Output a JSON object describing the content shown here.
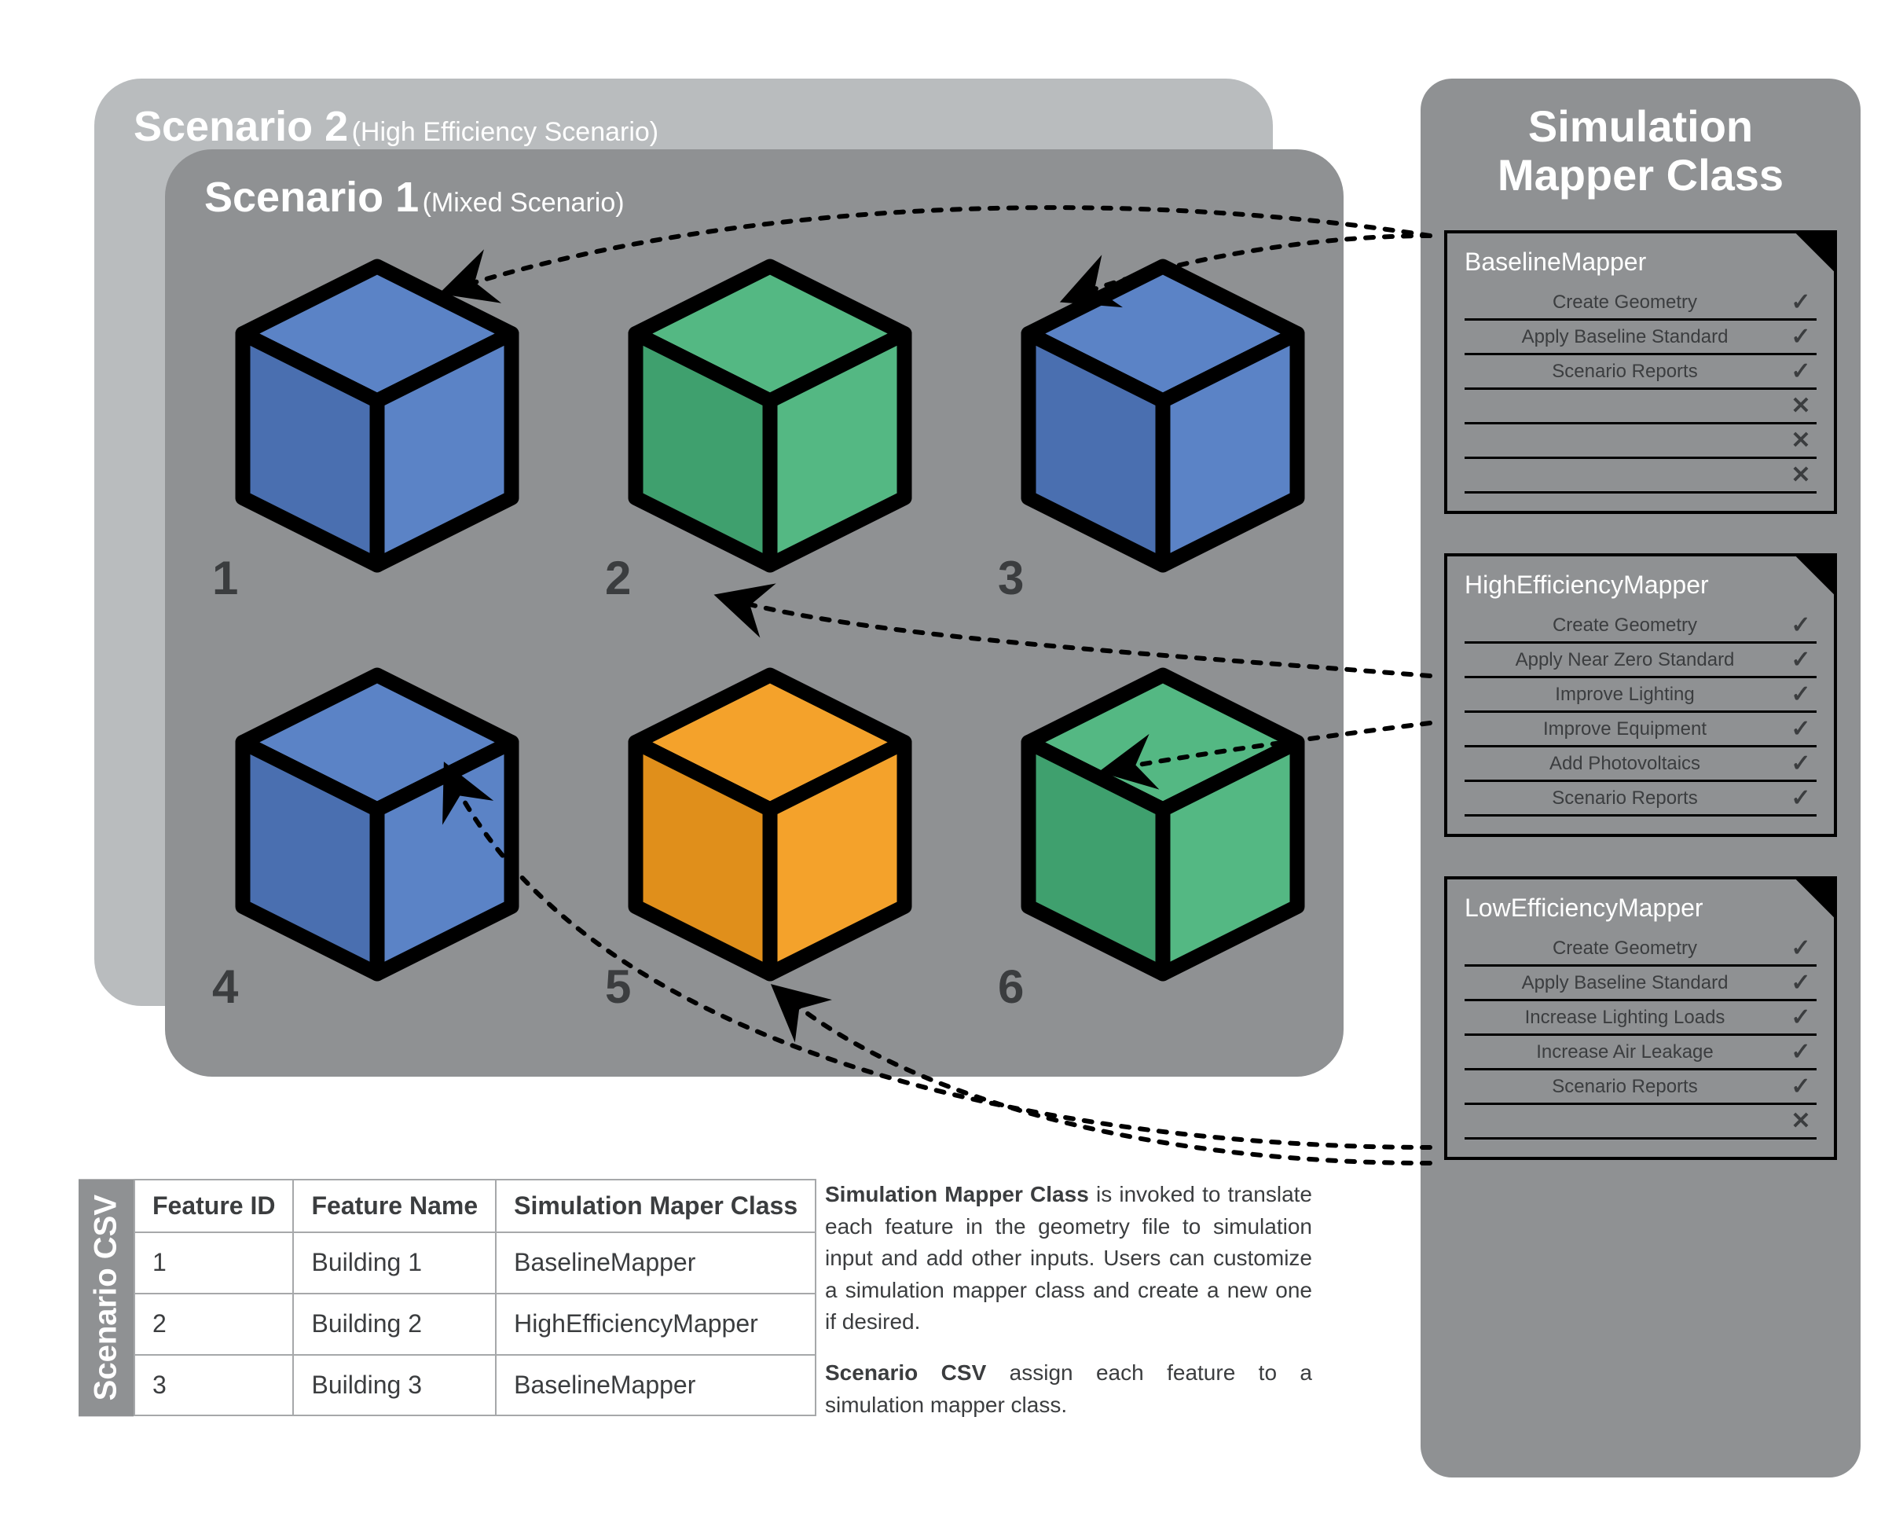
{
  "scenarios": {
    "s2": {
      "title": "Scenario 2",
      "sub": "(High Efficiency Scenario)"
    },
    "s1": {
      "title": "Scenario 1",
      "sub": "(Mixed Scenario)"
    }
  },
  "cubes": [
    {
      "n": "1",
      "color": "blue"
    },
    {
      "n": "2",
      "color": "green"
    },
    {
      "n": "3",
      "color": "blue"
    },
    {
      "n": "4",
      "color": "blue"
    },
    {
      "n": "5",
      "color": "orange"
    },
    {
      "n": "6",
      "color": "green"
    }
  ],
  "cube_colors": {
    "blue": {
      "top": "#5b83c6",
      "left": "#4a6fb0",
      "right": "#5b83c6"
    },
    "green": {
      "top": "#54b883",
      "left": "#3fa06e",
      "right": "#54b883"
    },
    "orange": {
      "top": "#f4a22b",
      "left": "#e08f1b",
      "right": "#f4a22b"
    }
  },
  "sidebar": {
    "title_l1": "Simulation",
    "title_l2": "Mapper Class",
    "mappers": [
      {
        "name": "BaselineMapper",
        "lines": [
          {
            "label": "Create Geometry",
            "check": true
          },
          {
            "label": "Apply Baseline Standard",
            "check": true
          },
          {
            "label": "Scenario Reports",
            "check": true
          },
          {
            "label": "",
            "check": false
          },
          {
            "label": "",
            "check": false
          },
          {
            "label": "",
            "check": false
          }
        ]
      },
      {
        "name": "HighEfficiencyMapper",
        "lines": [
          {
            "label": "Create Geometry",
            "check": true
          },
          {
            "label": "Apply Near Zero Standard",
            "check": true
          },
          {
            "label": "Improve Lighting",
            "check": true
          },
          {
            "label": "Improve Equipment",
            "check": true
          },
          {
            "label": "Add Photovoltaics",
            "check": true
          },
          {
            "label": "Scenario Reports",
            "check": true
          }
        ]
      },
      {
        "name": "LowEfficiencyMapper",
        "lines": [
          {
            "label": "Create Geometry",
            "check": true
          },
          {
            "label": "Apply Baseline Standard",
            "check": true
          },
          {
            "label": "Increase Lighting Loads",
            "check": true
          },
          {
            "label": "Increase Air Leakage",
            "check": true
          },
          {
            "label": "Scenario Reports",
            "check": true
          },
          {
            "label": "",
            "check": false
          }
        ]
      }
    ]
  },
  "csv": {
    "tab": "Scenario CSV",
    "headers": [
      "Feature ID",
      "Feature Name",
      "Simulation Maper Class"
    ],
    "rows": [
      [
        "1",
        "Building 1",
        "BaselineMapper"
      ],
      [
        "2",
        "Building 2",
        "HighEfficiencyMapper"
      ],
      [
        "3",
        "Building 3",
        "BaselineMapper"
      ]
    ]
  },
  "desc": {
    "p1_b": "Simulation Mapper Class",
    "p1": " is invoked to translate each feature in the geometry file to simulation input and add other inputs. Users can customize a simulation mapper class and create a new one if desired.",
    "p2_b": "Scenario CSV",
    "p2": " assign each feature to a simulation mapper class."
  }
}
